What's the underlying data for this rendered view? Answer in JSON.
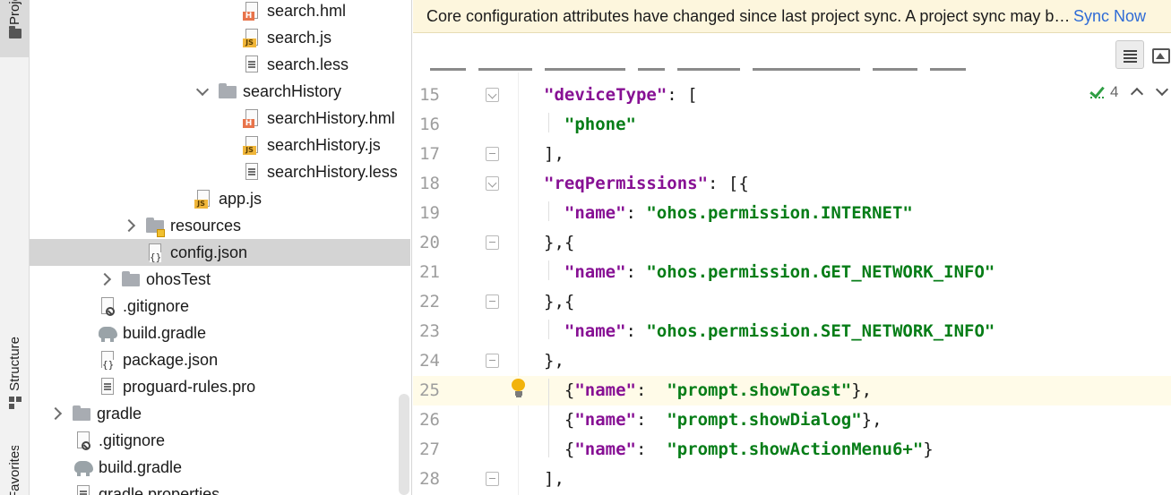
{
  "tool_windows": {
    "project_label": "Project",
    "structure_label": "Structure",
    "favorites_label": "Favorites"
  },
  "tree": {
    "items": [
      {
        "label": "search.hml",
        "icon": "hml-file-icon"
      },
      {
        "label": "search.js",
        "icon": "js-file-icon"
      },
      {
        "label": "search.less",
        "icon": "text-file-icon"
      },
      {
        "label": "searchHistory",
        "icon": "folder-icon",
        "expanded": true
      },
      {
        "label": "searchHistory.hml",
        "icon": "hml-file-icon"
      },
      {
        "label": "searchHistory.js",
        "icon": "js-file-icon"
      },
      {
        "label": "searchHistory.less",
        "icon": "text-file-icon"
      },
      {
        "label": "app.js",
        "icon": "js-file-icon"
      },
      {
        "label": "resources",
        "icon": "resources-folder-icon",
        "expanded": false
      },
      {
        "label": "config.json",
        "icon": "json-file-icon",
        "selected": true
      },
      {
        "label": "ohosTest",
        "icon": "folder-icon",
        "expanded": false
      },
      {
        "label": ".gitignore",
        "icon": "gitignore-file-icon"
      },
      {
        "label": "build.gradle",
        "icon": "gradle-file-icon"
      },
      {
        "label": "package.json",
        "icon": "json-file-icon"
      },
      {
        "label": "proguard-rules.pro",
        "icon": "text-file-icon"
      },
      {
        "label": "gradle",
        "icon": "folder-icon",
        "expanded": false
      },
      {
        "label": ".gitignore",
        "icon": "gitignore-file-icon"
      },
      {
        "label": "build.gradle",
        "icon": "gradle-file-icon"
      },
      {
        "label": "gradle.properties",
        "icon": "text-file-icon"
      }
    ]
  },
  "banner": {
    "message": "Core configuration attributes have changed since last project sync. A project sync may be required for the IDE to apply the changes.",
    "action": "Sync Now"
  },
  "inspection": {
    "warning_count": "4"
  },
  "editor": {
    "lines": [
      {
        "num": "15",
        "parts": [
          [
            "k",
            "\"deviceType\""
          ],
          [
            "p",
            ": ["
          ]
        ]
      },
      {
        "num": "16",
        "parts": [
          [
            "p",
            "  "
          ],
          [
            "s",
            "\"phone\""
          ]
        ]
      },
      {
        "num": "17",
        "parts": [
          [
            "p",
            "],"
          ]
        ]
      },
      {
        "num": "18",
        "parts": [
          [
            "k",
            "\"reqPermissions\""
          ],
          [
            "p",
            ": [{"
          ]
        ]
      },
      {
        "num": "19",
        "parts": [
          [
            "p",
            "  "
          ],
          [
            "k",
            "\"name\""
          ],
          [
            "p",
            ": "
          ],
          [
            "s",
            "\"ohos.permission.INTERNET\""
          ]
        ]
      },
      {
        "num": "20",
        "parts": [
          [
            "p",
            "},{"
          ]
        ]
      },
      {
        "num": "21",
        "parts": [
          [
            "p",
            "  "
          ],
          [
            "k",
            "\"name\""
          ],
          [
            "p",
            ": "
          ],
          [
            "s",
            "\"ohos.permission.GET_NETWORK_INFO\""
          ]
        ]
      },
      {
        "num": "22",
        "parts": [
          [
            "p",
            "},{"
          ]
        ]
      },
      {
        "num": "23",
        "parts": [
          [
            "p",
            "  "
          ],
          [
            "k",
            "\"name\""
          ],
          [
            "p",
            ": "
          ],
          [
            "s",
            "\"ohos.permission.SET_NETWORK_INFO\""
          ]
        ]
      },
      {
        "num": "24",
        "parts": [
          [
            "p",
            "},"
          ]
        ]
      },
      {
        "num": "25",
        "parts": [
          [
            "p",
            "  {"
          ],
          [
            "k",
            "\"name\""
          ],
          [
            "p",
            ":  "
          ],
          [
            "s",
            "\"prompt.showToast\""
          ],
          [
            "p",
            "},"
          ]
        ]
      },
      {
        "num": "26",
        "parts": [
          [
            "p",
            "  {"
          ],
          [
            "k",
            "\"name\""
          ],
          [
            "p",
            ":  "
          ],
          [
            "s",
            "\"prompt.showDialog\""
          ],
          [
            "p",
            "},"
          ]
        ]
      },
      {
        "num": "27",
        "parts": [
          [
            "p",
            "  {"
          ],
          [
            "k",
            "\"name\""
          ],
          [
            "p",
            ":  "
          ],
          [
            "s",
            "\"prompt.showActionMenu6+\""
          ],
          [
            "p",
            "}"
          ]
        ]
      },
      {
        "num": "28",
        "parts": [
          [
            "p",
            "],"
          ]
        ]
      }
    ]
  }
}
